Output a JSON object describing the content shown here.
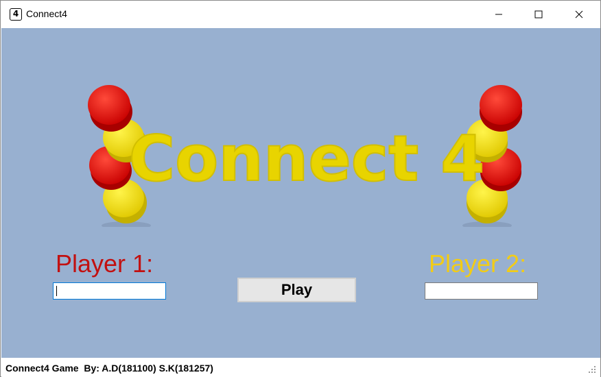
{
  "window": {
    "icon_text": "4",
    "title": "Connect4",
    "controls": [
      "minimize-icon",
      "maximize-icon",
      "close-icon"
    ]
  },
  "logo": {
    "text": "Connect 4",
    "colors": {
      "text": "#e8d400",
      "red_disc": "#ee1111",
      "yellow_disc": "#f7e612"
    }
  },
  "players": {
    "p1_label": "Player 1:",
    "p1_value": "",
    "p2_label": "Player 2:",
    "p2_value": "",
    "p1_color": "#c21010",
    "p2_color": "#f2cc16"
  },
  "play_button": {
    "label": "Play"
  },
  "status": {
    "text": "Connect4 Game  By: A.D(181100) S.K(181257)"
  },
  "colors": {
    "background": "#98b0d0"
  }
}
